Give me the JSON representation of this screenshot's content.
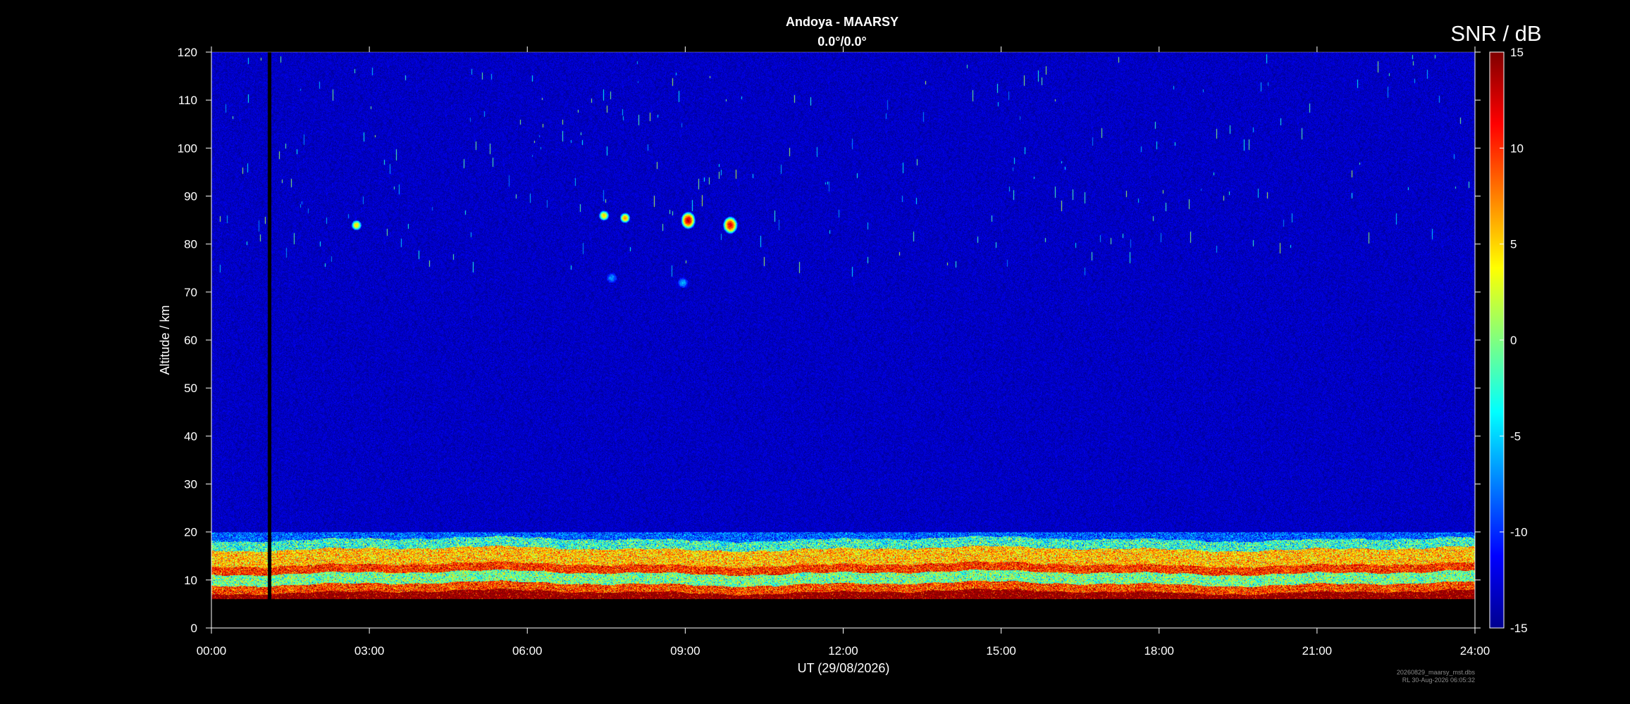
{
  "chart_data": {
    "type": "heatmap",
    "title": "Andoya - MAARSY",
    "subtitle": "0.0°/0.0°",
    "xlabel": "UT (29/08/2026)",
    "ylabel": "Altitude / km",
    "x_ticks": [
      "00:00",
      "03:00",
      "06:00",
      "09:00",
      "12:00",
      "15:00",
      "18:00",
      "21:00",
      "24:00"
    ],
    "xlim": [
      0,
      24
    ],
    "y_ticks": [
      0,
      10,
      20,
      30,
      40,
      50,
      60,
      70,
      80,
      90,
      100,
      110,
      120
    ],
    "ylim": [
      0,
      120
    ],
    "colorbar": {
      "label": "SNR / dB",
      "ticks": [
        15,
        10,
        5,
        0,
        -5,
        -10,
        -15
      ],
      "range": [
        -15,
        15
      ],
      "colormap": "jet"
    },
    "data_gap": {
      "time_h": 1.1,
      "alt_km": [
        6,
        120
      ]
    },
    "background_snr_db": -13,
    "troposphere_echoes": {
      "alt_km": [
        6,
        20
      ],
      "snr_db_min": -5,
      "snr_db_max": 15
    },
    "echoes": [
      {
        "time_h": 2.75,
        "alt_km": 84,
        "snr_db": 5
      },
      {
        "time_h": 7.45,
        "alt_km": 86,
        "snr_db": 5
      },
      {
        "time_h": 7.85,
        "alt_km": 85.5,
        "snr_db": 7
      },
      {
        "time_h": 9.05,
        "alt_km": 85,
        "snr_db": 13
      },
      {
        "time_h": 9.85,
        "alt_km": 84,
        "snr_db": 12
      },
      {
        "time_h": 7.6,
        "alt_km": 73,
        "snr_db": -7
      },
      {
        "time_h": 8.95,
        "alt_km": 72,
        "snr_db": -6
      }
    ],
    "footer_lines": [
      "20260829_maarsy_mst.dbs",
      "RL 30-Aug-2026 06:05:32"
    ]
  },
  "colors": {
    "background": "#000000",
    "foreground": "#ffffff"
  }
}
